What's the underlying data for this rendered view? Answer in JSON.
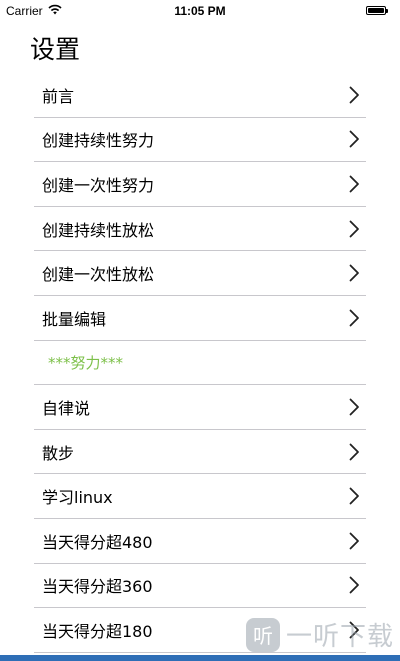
{
  "status_bar": {
    "carrier": "Carrier",
    "time": "11:05 PM"
  },
  "page": {
    "title": "设置"
  },
  "rows": [
    {
      "label": "前言",
      "type": "link"
    },
    {
      "label": "创建持续性努力",
      "type": "link"
    },
    {
      "label": "创建一次性努力",
      "type": "link"
    },
    {
      "label": "创建持续性放松",
      "type": "link"
    },
    {
      "label": "创建一次性放松",
      "type": "link"
    },
    {
      "label": "批量编辑",
      "type": "link"
    },
    {
      "label": "***努力***",
      "type": "section"
    },
    {
      "label": "自律说",
      "type": "link"
    },
    {
      "label": "散步",
      "type": "link"
    },
    {
      "label": "学习linux",
      "type": "link"
    },
    {
      "label": "当天得分超480",
      "type": "link"
    },
    {
      "label": "当天得分超360",
      "type": "link"
    },
    {
      "label": "当天得分超180",
      "type": "link"
    }
  ],
  "watermark": {
    "logo": "听",
    "text": "一听下载"
  },
  "colors": {
    "section_text": "#7dc04a",
    "separator": "#c8c7cc",
    "bottom_bar": "#2e6eb6"
  }
}
